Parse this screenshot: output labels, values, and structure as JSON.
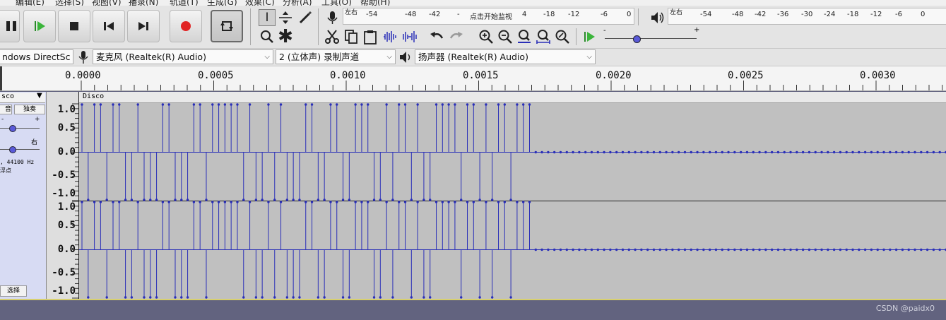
{
  "menu": [
    "编辑(E)",
    "选择(S)",
    "视图(V)",
    "播录(N)",
    "轨道(T)",
    "生成(G)",
    "效果(C)",
    "分析(A)",
    "工具(O)",
    "帮助(H)"
  ],
  "transport": {
    "pause": "pause",
    "play": "play",
    "stop": "stop",
    "skip_start": "skip-to-start",
    "skip_end": "skip-to-end",
    "record": "record",
    "loop": "loop"
  },
  "record_meter": {
    "lr": "左右",
    "ticks": [
      "-54",
      "-48",
      "-42",
      "-",
      "-18",
      "-12",
      "-6",
      "0"
    ],
    "hint": "点击开始监视",
    "hint_tick": "4"
  },
  "play_meter": {
    "lr": "左右",
    "ticks": [
      "-54",
      "-48",
      "-42",
      "-36",
      "-30",
      "-24",
      "-18",
      "-12",
      "-6",
      "0"
    ]
  },
  "devices": {
    "host": "ndows DirectSc",
    "input": "麦克风 (Realtek(R) Audio)",
    "channels": "2 (立体声) 录制声道",
    "output": "扬声器 (Realtek(R) Audio)"
  },
  "ruler": {
    "labels": [
      "0.0000",
      "0.0005",
      "0.0010",
      "0.0015",
      "0.0020",
      "0.0025",
      "0.0030"
    ]
  },
  "track": {
    "name_short": "sco",
    "name": "Disco",
    "mute_partial": "音",
    "solo": "独奏",
    "pan_right": "右",
    "gain_plus": "+",
    "gain_minus": "-",
    "info_rate": ", 44100 Hz",
    "info_format": "浮点",
    "select": "选择"
  },
  "vertical_scale": [
    "1.0",
    "0.5",
    "0.0",
    "-0.5",
    "-1.0"
  ],
  "waveform": {
    "color": "#2a2fb8",
    "sample_rate_hz": 44100,
    "samples_per_channel": 140,
    "bits_visible": "1011011001000110001101111101001010001100110011100101101001111011010110111",
    "silence_level": 0
  },
  "watermark": "CSDN @paidx0"
}
